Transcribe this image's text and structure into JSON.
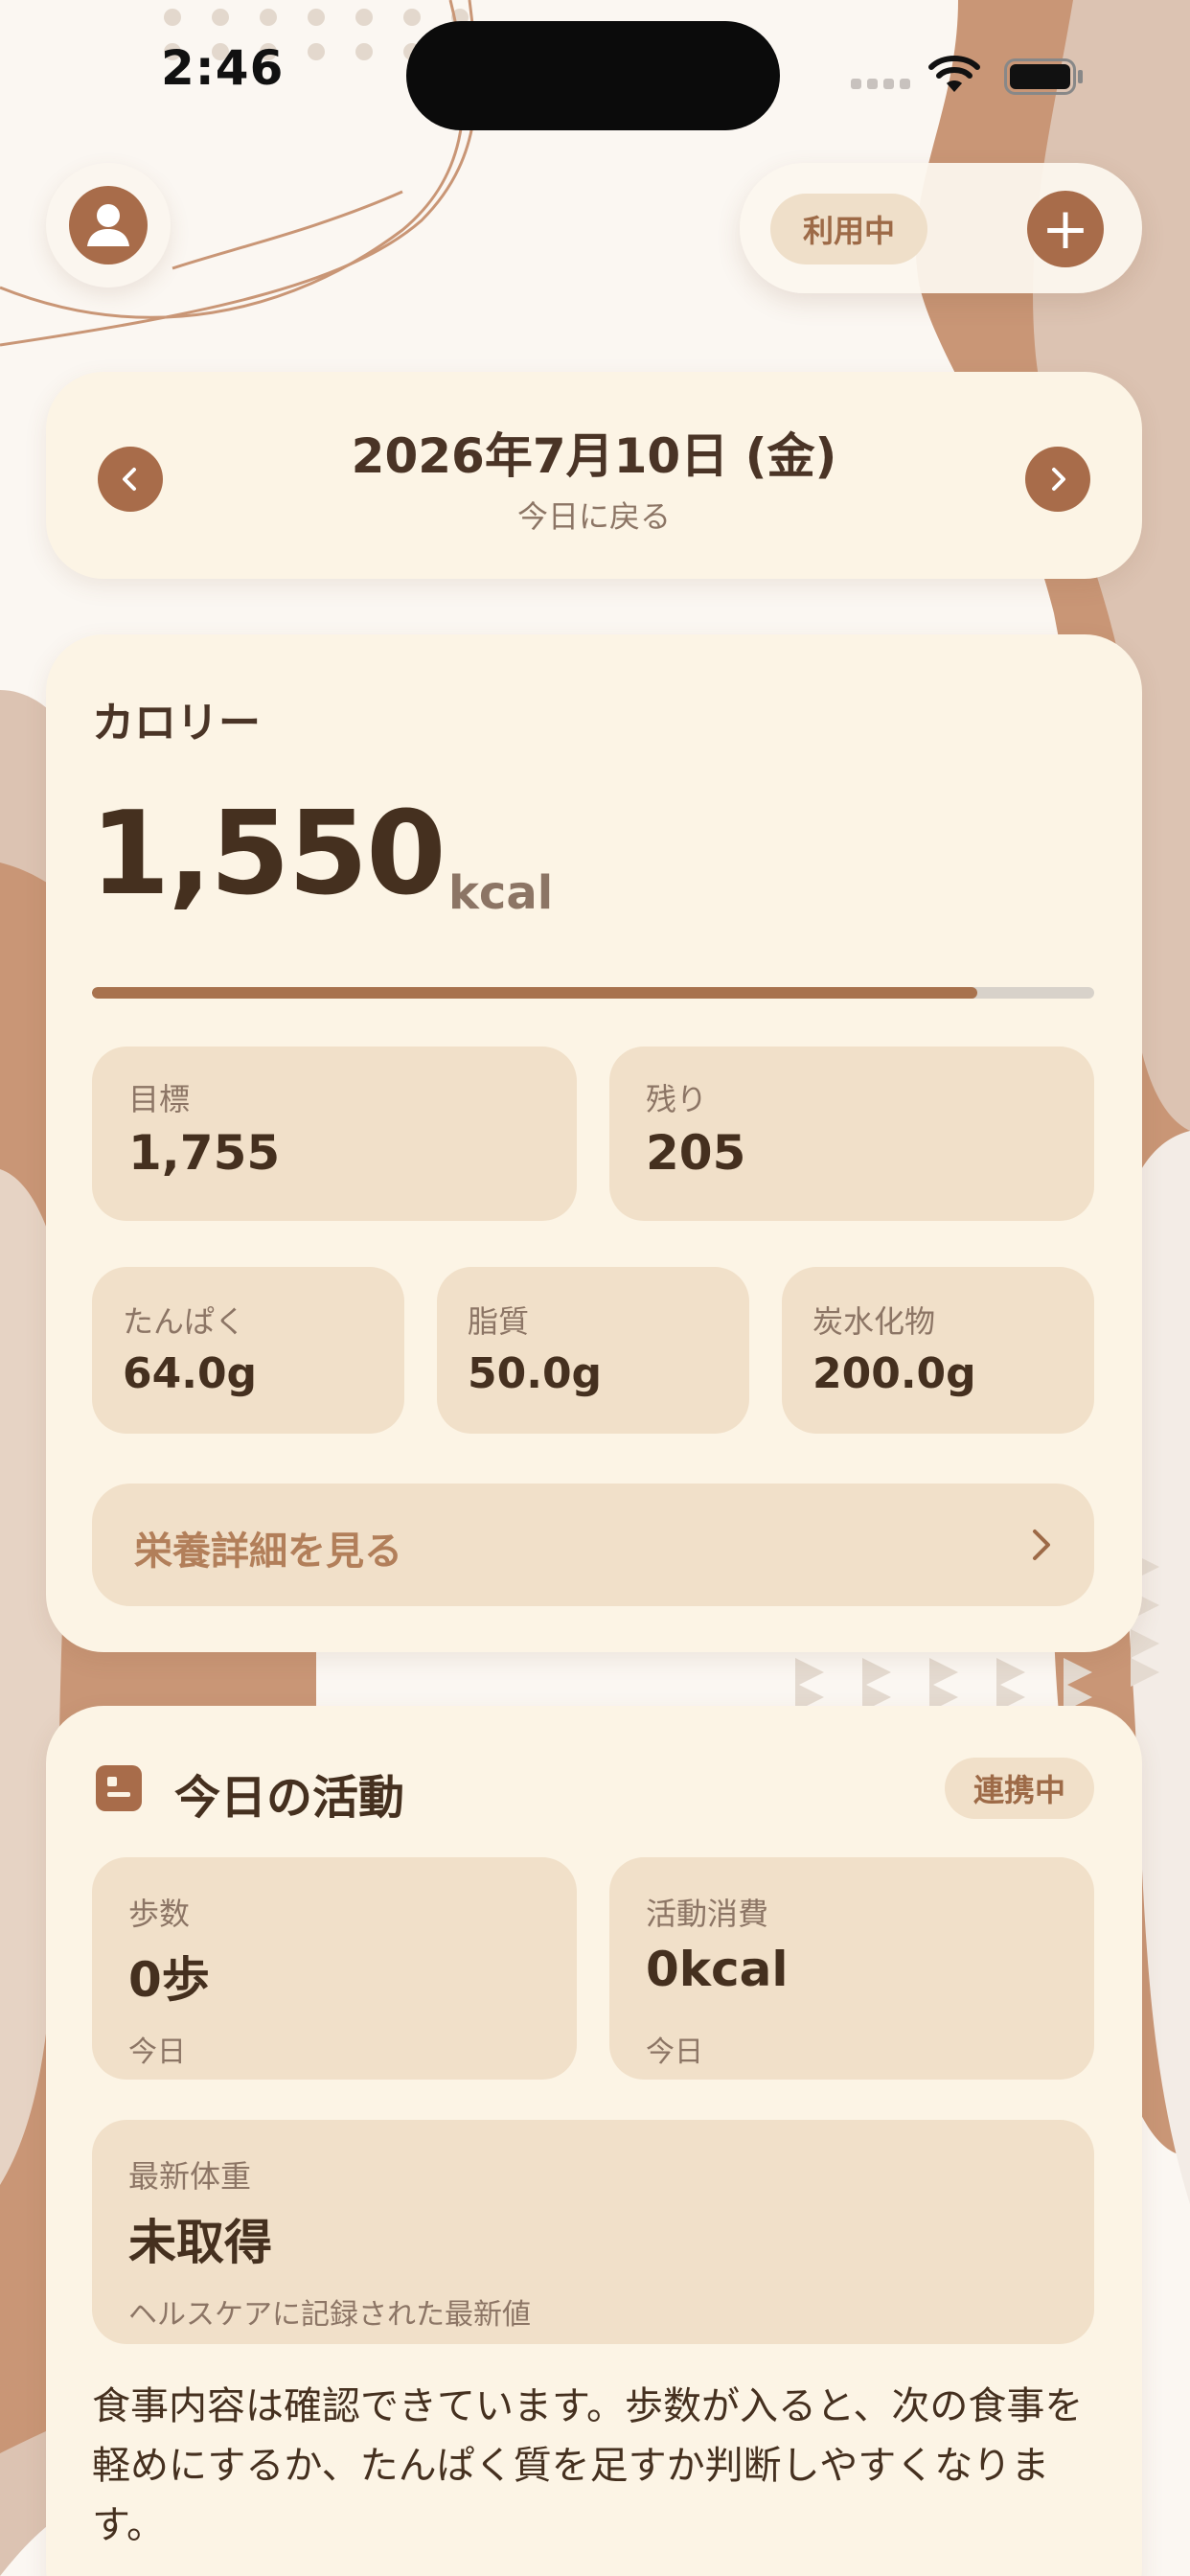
{
  "status_bar": {
    "time": "2:46"
  },
  "header": {
    "usage_badge": "利用中",
    "add_label": "+"
  },
  "date_nav": {
    "title": "2026年7月10日 (金)",
    "back_to_today": "今日に戻る"
  },
  "calories": {
    "title": "カロリー",
    "value": "1,550",
    "unit": "kcal",
    "progress": 0.883,
    "goal": {
      "label": "目標",
      "value": "1,755"
    },
    "remaining": {
      "label": "残り",
      "value": "205"
    },
    "macros": [
      {
        "label": "たんぱく",
        "value": "64.0g"
      },
      {
        "label": "脂質",
        "value": "50.0g"
      },
      {
        "label": "炭水化物",
        "value": "200.0g"
      }
    ],
    "detail_button": "栄養詳細を見る"
  },
  "activity": {
    "title": "今日の活動",
    "linked_badge": "連携中",
    "steps": {
      "label": "歩数",
      "value": "0歩",
      "note": "今日"
    },
    "active_burn": {
      "label": "活動消費",
      "value": "0kcal",
      "note": "今日"
    },
    "weight": {
      "label": "最新体重",
      "value": "未取得",
      "note": "ヘルスケアに記録された最新値"
    },
    "description": "食事内容は確認できています。歩数が入ると、次の食事を軽めにするか、たんぱく質を足すか判断しやすくなります。"
  },
  "colors": {
    "accent": "#a86c4a",
    "card": "#fcf4e5",
    "tile": "#f1e0c9",
    "text": "#45301f"
  }
}
